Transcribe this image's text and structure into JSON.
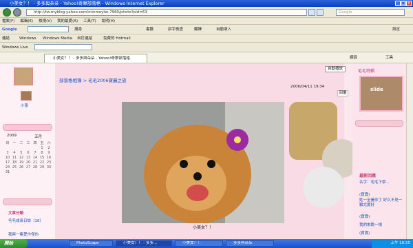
{
  "window": {
    "title": "小美女？！ - 多多與朵朵 - Yahoo!奇摩部落格 - Windows Internet Explorer"
  },
  "address": {
    "url": "http://tw.myblog.yahoo.com/minmoytw-7960/photo?pid=63",
    "search_placeholder": "Google"
  },
  "menu": [
    "檔案(F)",
    "編輯(E)",
    "檢視(V)",
    "我的最愛(A)",
    "工具(T)",
    "說明(H)"
  ],
  "google_bar": {
    "label": "Google",
    "search_btn": "搜尋",
    "bookmarks": "書籤",
    "spell": "拼字檢查",
    "translate": "翻譯",
    "autofill": "自動填入",
    "settings": "設定"
  },
  "links_bar": {
    "label": "連結",
    "items": [
      "Windows",
      "Windows Media",
      "自訂連結",
      "免費的 Hotmail"
    ]
  },
  "live_bar": {
    "label": "Windows Live"
  },
  "tabs": [
    {
      "label": "小美女？！ - 多多與朵朵 - Yahoo!奇摩部落格"
    }
  ],
  "command_bar": {
    "page": "網頁",
    "tools": "工具"
  },
  "left": {
    "user": "小靈",
    "calendar": {
      "year": "2009",
      "month": "五月",
      "weekdays": [
        "日",
        "一",
        "二",
        "三",
        "四",
        "五",
        "六"
      ],
      "days": [
        "",
        "",
        "",
        "",
        "",
        "1",
        "2",
        "3",
        "4",
        "5",
        "6",
        "7",
        "8",
        "9",
        "10",
        "11",
        "12",
        "13",
        "14",
        "15",
        "16",
        "17",
        "18",
        "19",
        "20",
        "21",
        "22",
        "23",
        "24",
        "25",
        "26",
        "27",
        "28",
        "29",
        "30",
        "31",
        "",
        "",
        "",
        "",
        "",
        ""
      ]
    },
    "section": "文章分類",
    "cats": [
      "毛毛成長日誌（18）",
      "我與一隻愛作怪的"
    ]
  },
  "center": {
    "autoplay": "自動播放",
    "breadcrumb": "部落格相簿 > 毛毛2006寶麗之旅",
    "date": "2006/04/11 19:34",
    "reply": "回覆",
    "caption": "小美女？！"
  },
  "right": {
    "title": "毛毛特輯",
    "slide": "slide",
    "recent": "最新回應",
    "links": [
      "名字：毛毛下學...",
      "(寶寶)",
      "姓一至養你了 好久不見一顆尤愛好",
      "(寶寶)",
      "我們來跳一場",
      "(寶寶)"
    ]
  },
  "taskbar": {
    "start": "開始",
    "items": [
      "PhotoScape",
      "小美女？！ - 多多...",
      "小美女？！",
      "多多與朵朵"
    ],
    "time": "上午 10:55"
  },
  "colors": {
    "title": "#0a3fc0",
    "pink": "#c7407a",
    "link": "#1a55b8"
  }
}
